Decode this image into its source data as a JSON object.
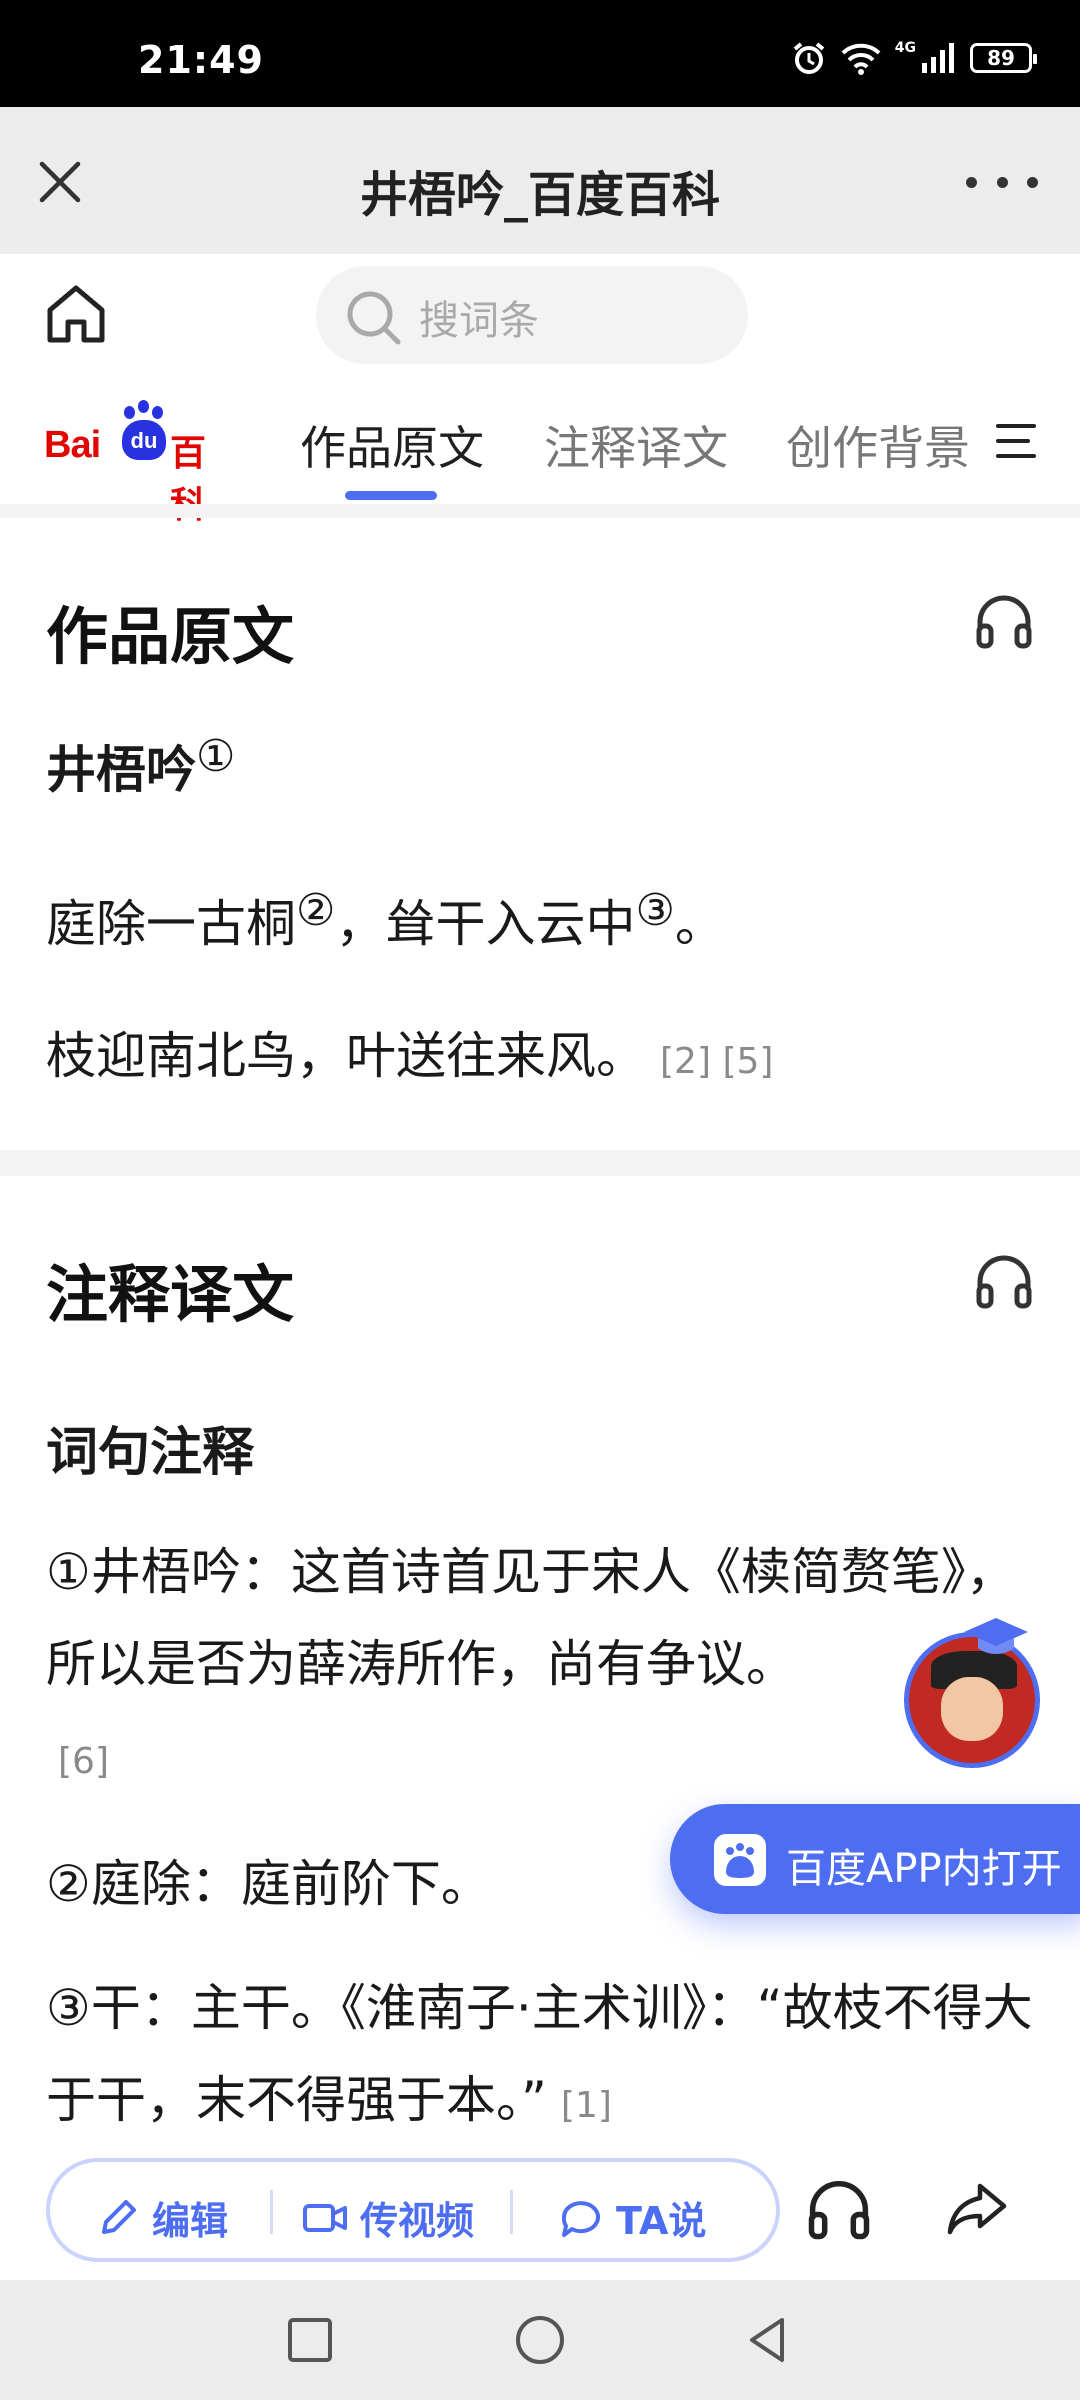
{
  "status_bar": {
    "time": "21:49",
    "network": "4G",
    "battery": "89"
  },
  "browser_header": {
    "title": "井梧吟_百度百科"
  },
  "search": {
    "placeholder": "搜词条"
  },
  "logo": {
    "bai": "Bai",
    "du": "du",
    "baike": "百科"
  },
  "tabs": [
    {
      "label": "作品原文",
      "active": true
    },
    {
      "label": "注释译文",
      "active": false
    },
    {
      "label": "创作背景",
      "active": false
    }
  ],
  "section_original": {
    "title": "作品原文",
    "poem_title": "井梧吟",
    "poem_title_mark": "①",
    "line1": {
      "part1": "庭除一古桐",
      "mark1": "②",
      "part2": "，耸干入云中",
      "mark2": "③",
      "part3": "。"
    },
    "line2": {
      "text": "枝迎南北鸟，叶送往来风。",
      "refs": "[2] [5]"
    }
  },
  "section_notes": {
    "title": "注释译文",
    "subtitle": "词句注释",
    "note1": {
      "text": "①井梧吟：这首诗首见于宋人《椟简赘笔》，所以是否为薛涛所作，尚有争议。",
      "ref": "[6]"
    },
    "note2": {
      "text": "②庭除：庭前阶下。"
    },
    "note3": {
      "text": "③干：主干。《淮南子·主术训》：“故枝不得大于干，末不得强于本。”",
      "ref": "[1]"
    }
  },
  "floating": {
    "open_app_label": "百度APP内打开"
  },
  "toolbar": {
    "edit_label": "编辑",
    "video_label": "传视频",
    "ta_label": "TA说"
  },
  "colors": {
    "accent": "#4e6ef2",
    "brand_red": "#e10602",
    "brand_blue": "#2932e1"
  }
}
